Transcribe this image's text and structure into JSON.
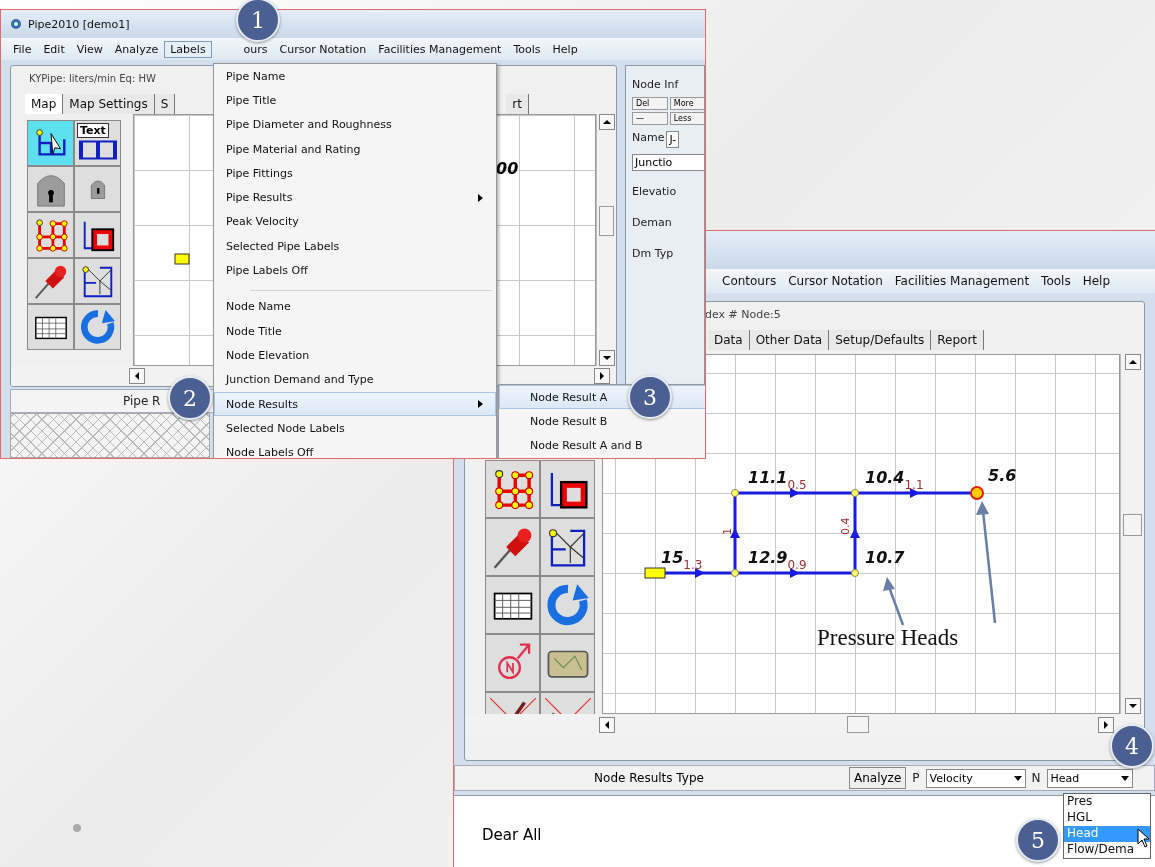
{
  "front_window": {
    "title": "Pipe2010  [demo1]",
    "menu": [
      {
        "label": "File",
        "selected": false
      },
      {
        "label": "Edit",
        "selected": false
      },
      {
        "label": "View",
        "selected": false
      },
      {
        "label": "Analyze",
        "selected": false
      },
      {
        "label": "Labels",
        "selected": true
      },
      {
        "label": "ours",
        "selected": false
      },
      {
        "label": "Cursor Notation",
        "selected": false
      },
      {
        "label": "Facilities Management",
        "selected": false
      },
      {
        "label": "Tools",
        "selected": false
      },
      {
        "label": "Help",
        "selected": false
      }
    ],
    "units": "KYPipe: liters/min  Eq: HW",
    "tabs": [
      {
        "label": "Map",
        "selected": true
      },
      {
        "label": "Map Settings",
        "selected": false
      },
      {
        "label": "S",
        "selected": false
      },
      {
        "label": "rt",
        "selected": false
      }
    ],
    "toolbox_text": "Text",
    "map_label": "00",
    "status": "Pipe R",
    "node_info": {
      "title": "Node Inf",
      "buttons": [
        "Del",
        "More",
        "—",
        "Less"
      ],
      "name_label": "Name",
      "name_value": "J-",
      "type": "Junctio",
      "fields": [
        "Elevatio",
        "Deman",
        "Dm Typ"
      ]
    },
    "labels_menu": [
      {
        "kind": "item",
        "label": "Pipe Name",
        "submenu": false,
        "selected": false
      },
      {
        "kind": "item",
        "label": "Pipe Title",
        "submenu": false,
        "selected": false
      },
      {
        "kind": "item",
        "label": "Pipe Diameter and Roughness",
        "submenu": false,
        "selected": false
      },
      {
        "kind": "item",
        "label": "Pipe Material and Rating",
        "submenu": false,
        "selected": false
      },
      {
        "kind": "item",
        "label": "Pipe Fittings",
        "submenu": false,
        "selected": false
      },
      {
        "kind": "item",
        "label": "Pipe Results",
        "submenu": true,
        "selected": false
      },
      {
        "kind": "item",
        "label": "Peak Velocity",
        "submenu": false,
        "selected": false
      },
      {
        "kind": "item",
        "label": "Selected Pipe Labels",
        "submenu": false,
        "selected": false
      },
      {
        "kind": "item",
        "label": "Pipe Labels Off",
        "submenu": false,
        "selected": false
      },
      {
        "kind": "separator"
      },
      {
        "kind": "item",
        "label": "Node Name",
        "submenu": false,
        "selected": false
      },
      {
        "kind": "item",
        "label": "Node Title",
        "submenu": false,
        "selected": false
      },
      {
        "kind": "item",
        "label": "Node Elevation",
        "submenu": false,
        "selected": false
      },
      {
        "kind": "item",
        "label": "Junction Demand and Type",
        "submenu": false,
        "selected": false
      },
      {
        "kind": "item",
        "label": "Node Results",
        "submenu": true,
        "selected": true
      },
      {
        "kind": "item",
        "label": "Selected Node Labels",
        "submenu": false,
        "selected": false
      },
      {
        "kind": "item",
        "label": "Node Labels Off",
        "submenu": false,
        "selected": false
      }
    ],
    "node_results_submenu": [
      {
        "label": "Node Result A",
        "selected": true
      },
      {
        "label": "Node Result B",
        "selected": false
      },
      {
        "label": "Node Result A and B",
        "selected": false
      }
    ]
  },
  "back_window": {
    "menu": [
      {
        "label": "Contours",
        "selected": false
      },
      {
        "label": "Cursor Notation",
        "selected": false
      },
      {
        "label": "Facilities Management",
        "selected": false
      },
      {
        "label": "Tools",
        "selected": false
      },
      {
        "label": "Help",
        "selected": false
      }
    ],
    "node_index": "dex #  Node:5",
    "tabs": [
      {
        "label": "Data",
        "selected": false
      },
      {
        "label": "Other Data",
        "selected": false
      },
      {
        "label": "Setup/Defaults",
        "selected": false
      },
      {
        "label": "Report",
        "selected": false
      }
    ],
    "network": {
      "pipe_labels": [
        {
          "head": "11.1",
          "flow": "0.5"
        },
        {
          "head": "10.4",
          "flow": "1.1"
        },
        {
          "head": "15",
          "flow": "1.3"
        },
        {
          "head": "12.9",
          "flow": "0.9"
        }
      ],
      "node_labels": [
        "5.6",
        "10.7"
      ],
      "vertical_flows": [
        "1",
        "0.4"
      ]
    },
    "annotation": "Pressure Heads",
    "status_bar": {
      "title": "Node Results Type",
      "analyze": "Analyze",
      "p_label": "P",
      "p_value": "Velocity",
      "n_label": "N",
      "n_value": "Head"
    },
    "n_options": [
      {
        "label": "Pres",
        "selected": false
      },
      {
        "label": "HGL",
        "selected": false
      },
      {
        "label": "Head",
        "selected": true
      },
      {
        "label": "Flow/Dema",
        "selected": false
      }
    ],
    "message": "Dear All"
  },
  "callouts": [
    "1",
    "2",
    "3",
    "4",
    "5"
  ]
}
